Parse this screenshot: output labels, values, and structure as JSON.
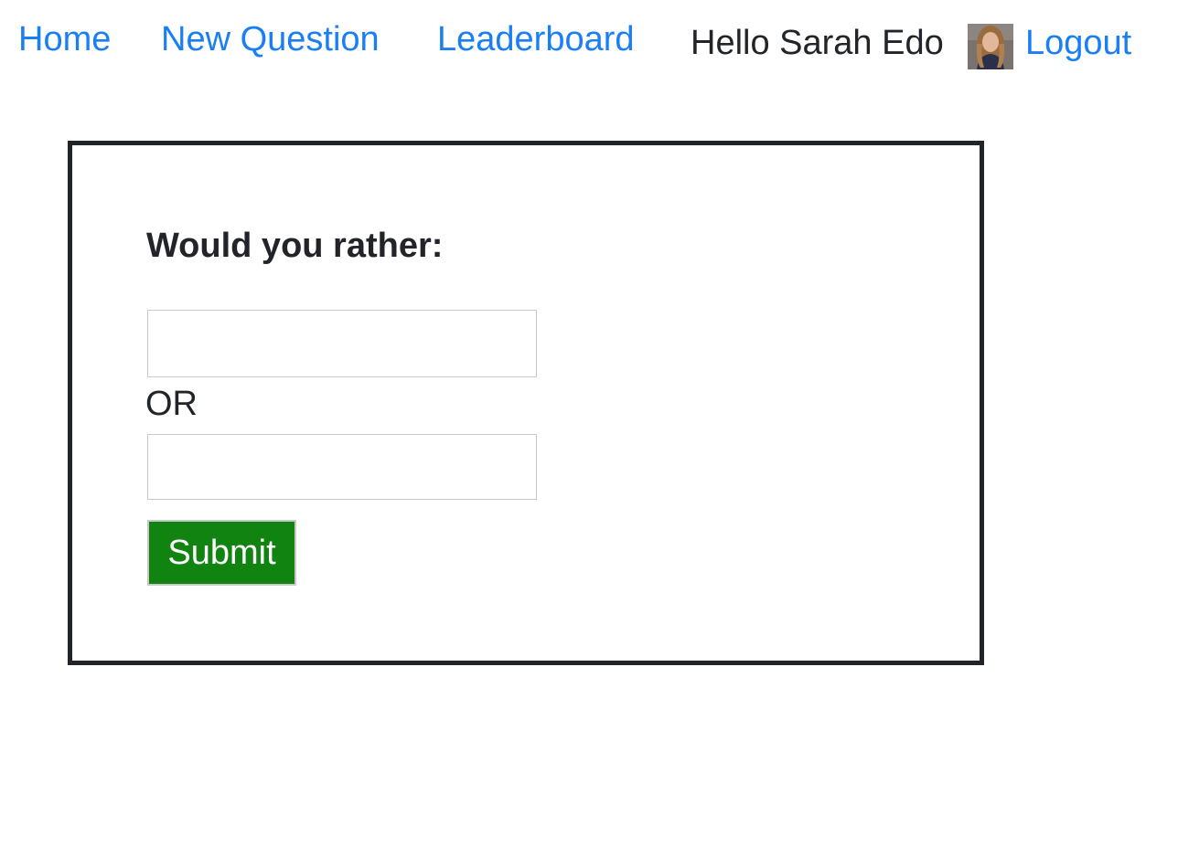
{
  "nav": {
    "home_label": "Home",
    "new_question_label": "New Question",
    "leaderboard_label": "Leaderboard",
    "greeting": "Hello Sarah Edo",
    "avatar_icon": "user-avatar-photo",
    "logout_label": "Logout"
  },
  "card": {
    "title": "Would you rather:",
    "option_one": {
      "value": "",
      "placeholder": ""
    },
    "separator": "OR",
    "option_two": {
      "value": "",
      "placeholder": ""
    },
    "submit_label": "Submit"
  },
  "colors": {
    "link": "#1a7ef5",
    "text": "#212529",
    "submit_bg": "#118311",
    "card_border": "#212529"
  }
}
